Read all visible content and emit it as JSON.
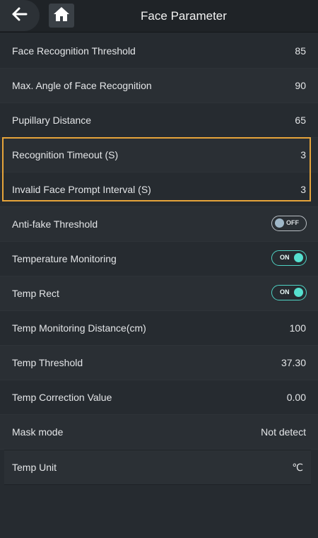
{
  "header": {
    "title": "Face Parameter",
    "back_icon": "arrow-left",
    "home_icon": "home"
  },
  "rows": [
    {
      "label": "Face Recognition Threshold",
      "value": "85"
    },
    {
      "label": "Max. Angle of Face Recognition",
      "value": "90"
    },
    {
      "label": "Pupillary Distance",
      "value": "65"
    },
    {
      "label": "Recognition Timeout (S)",
      "value": "3"
    },
    {
      "label": "Invalid Face Prompt Interval (S)",
      "value": "3"
    },
    {
      "label": "Anti-fake Threshold",
      "toggle": "OFF"
    },
    {
      "label": "Temperature Monitoring",
      "toggle": "ON"
    },
    {
      "label": "Temp Rect",
      "toggle": "ON"
    },
    {
      "label": "Temp Monitoring Distance(cm)",
      "value": "100"
    },
    {
      "label": "Temp Threshold",
      "value": "37.30"
    },
    {
      "label": "Temp Correction Value",
      "value": "0.00"
    },
    {
      "label": "Mask mode",
      "value": "Not detect"
    },
    {
      "label": "Temp Unit",
      "value": "℃"
    }
  ],
  "colors": {
    "highlight": "#e6a43a",
    "toggle_on": "#4fd3c4",
    "background": "#262b30"
  }
}
